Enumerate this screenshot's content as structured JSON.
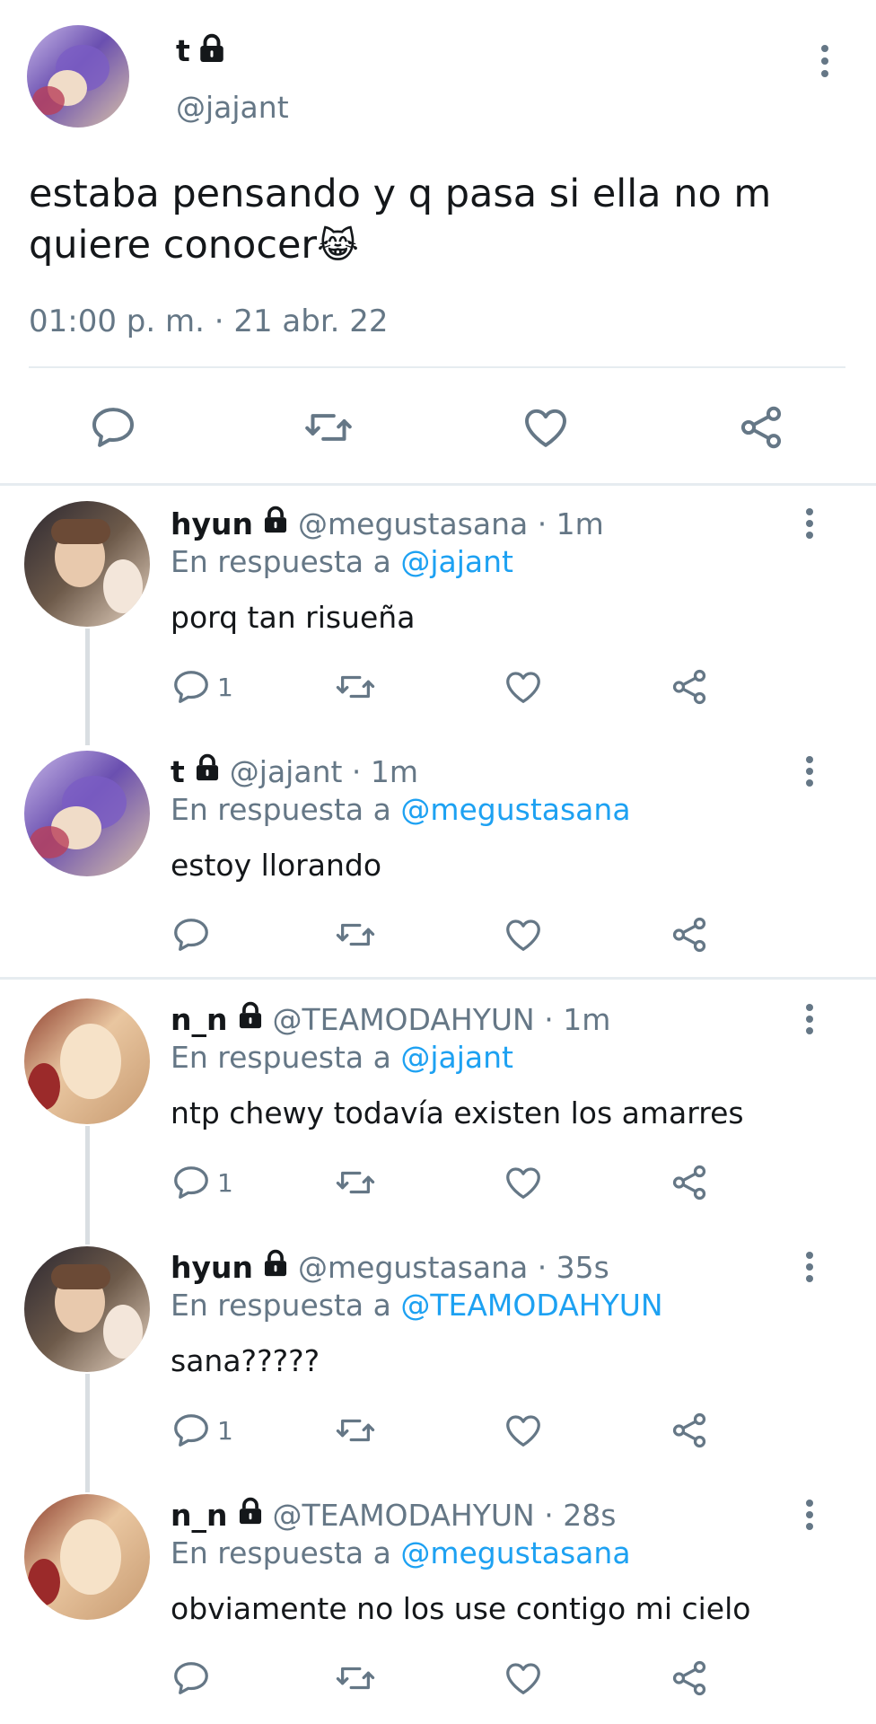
{
  "colors": {
    "accent": "#1da1f2",
    "muted": "#657786",
    "text": "#14171a",
    "divider": "#e6ecf0"
  },
  "main_tweet": {
    "name": "t",
    "handle": "@jajant",
    "text_line1": "estaba pensando y q pasa si ella no m",
    "text_line2": "quiere conocer",
    "emoji": "😹",
    "timestamp": "01:00 p. m. · 21 abr. 22",
    "actions": [
      "reply-icon",
      "retweet-icon",
      "like-icon",
      "share-icon"
    ]
  },
  "replies": [
    {
      "name": "hyun",
      "handle": "@megustasana · 1m",
      "reply_prefix": "En respuesta a",
      "reply_to": "@jajant",
      "text": "porq tan risueña",
      "reply_count": "1"
    },
    {
      "name": "t",
      "handle": "@jajant · 1m",
      "reply_prefix": "En respuesta a",
      "reply_to": "@megustasana",
      "text": "estoy llorando",
      "reply_count": ""
    },
    {
      "name": "n_n",
      "handle": "@TEAMODAHYUN · 1m",
      "reply_prefix": "En respuesta a",
      "reply_to": "@jajant",
      "text": "ntp chewy todavía existen los amarres",
      "reply_count": "1"
    },
    {
      "name": "hyun",
      "handle": "@megustasana · 35s",
      "reply_prefix": "En respuesta a",
      "reply_to": "@TEAMODAHYUN",
      "text": "sana?????",
      "reply_count": "1"
    },
    {
      "name": "n_n",
      "handle": "@TEAMODAHYUN · 28s",
      "reply_prefix": "En respuesta a",
      "reply_to": "@megustasana",
      "text": "obviamente no los use contigo mi cielo",
      "reply_count": ""
    }
  ]
}
